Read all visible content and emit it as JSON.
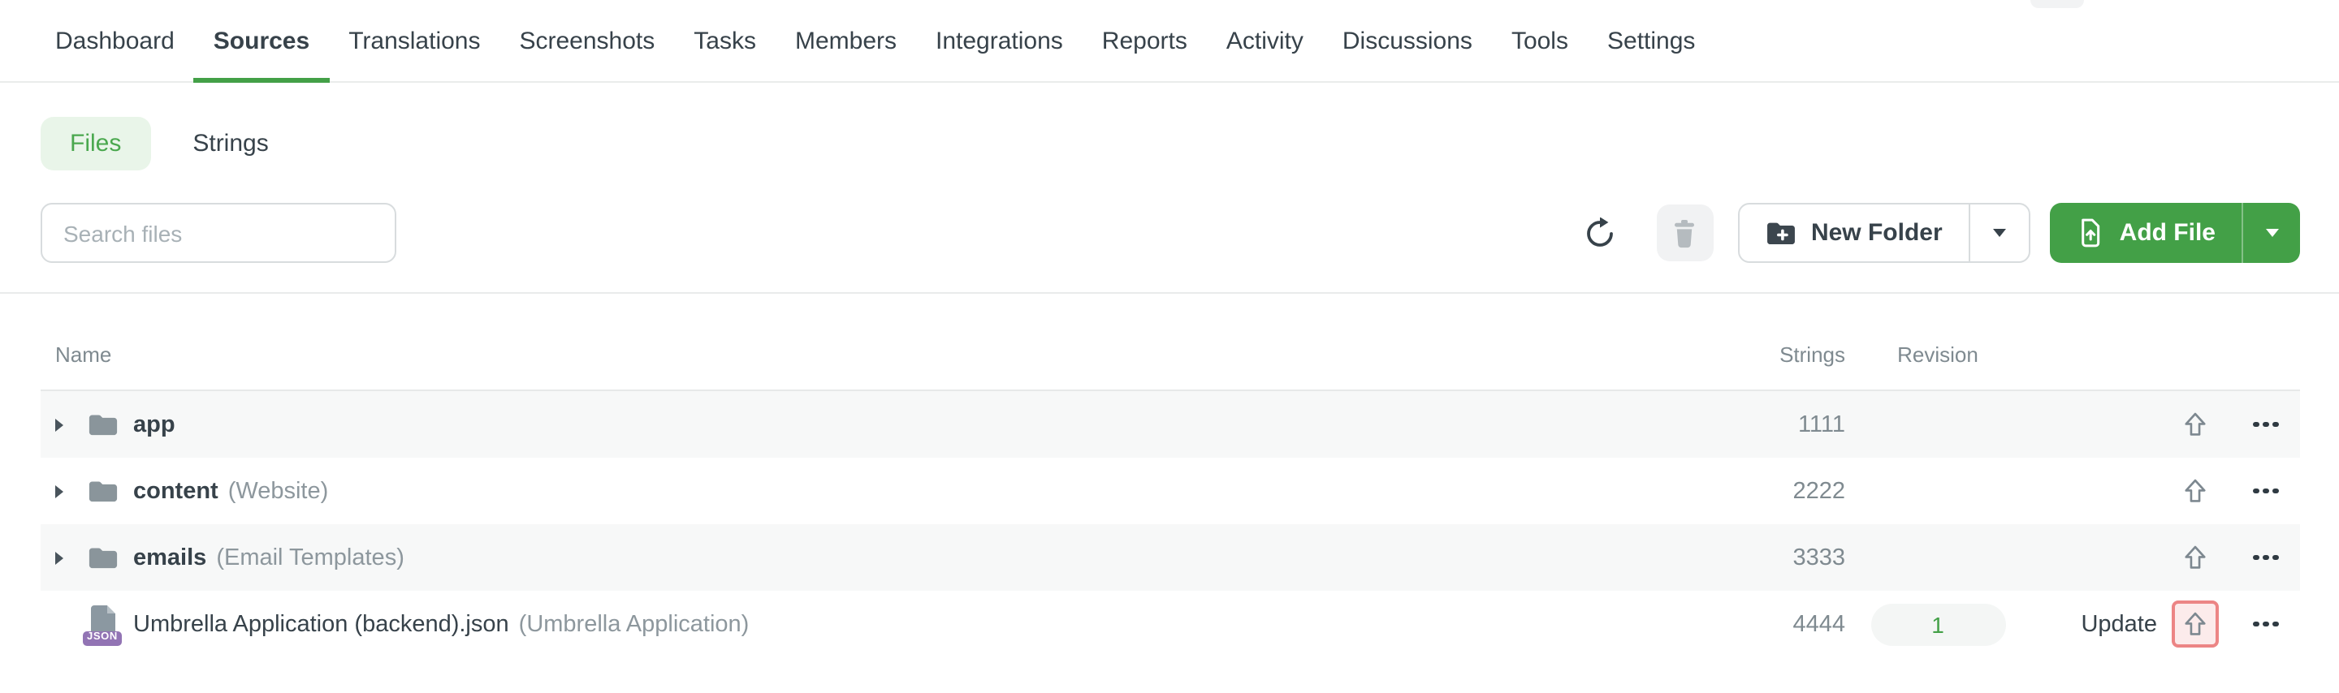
{
  "nav": {
    "items": [
      {
        "label": "Dashboard",
        "active": false
      },
      {
        "label": "Sources",
        "active": true
      },
      {
        "label": "Translations",
        "active": false
      },
      {
        "label": "Screenshots",
        "active": false
      },
      {
        "label": "Tasks",
        "active": false
      },
      {
        "label": "Members",
        "active": false
      },
      {
        "label": "Integrations",
        "active": false
      },
      {
        "label": "Reports",
        "active": false
      },
      {
        "label": "Activity",
        "active": false
      },
      {
        "label": "Discussions",
        "active": false
      },
      {
        "label": "Tools",
        "active": false
      },
      {
        "label": "Settings",
        "active": false
      }
    ]
  },
  "view_tabs": {
    "items": [
      {
        "label": "Files",
        "active": true
      },
      {
        "label": "Strings",
        "active": false
      }
    ]
  },
  "toolbar": {
    "search_placeholder": "Search files",
    "new_folder_label": "New Folder",
    "add_file_label": "Add File"
  },
  "table": {
    "columns": {
      "name": "Name",
      "strings": "Strings",
      "revision": "Revision"
    },
    "rows": [
      {
        "type": "folder",
        "name": "app",
        "note": "",
        "strings": "1111",
        "revision": "",
        "action": ""
      },
      {
        "type": "folder",
        "name": "content",
        "note": "(Website)",
        "strings": "2222",
        "revision": "",
        "action": ""
      },
      {
        "type": "folder",
        "name": "emails",
        "note": "(Email Templates)",
        "strings": "3333",
        "revision": "",
        "action": ""
      },
      {
        "type": "file",
        "name": "Umbrella Application (backend).json",
        "note": "(Umbrella Application)",
        "strings": "4444",
        "revision": "1",
        "action": "Update",
        "badge": "JSON",
        "highlighted": true
      }
    ]
  },
  "colors": {
    "accent_green": "#43a047",
    "files_tab_bg": "#e9f5e9",
    "files_tab_text": "#4aa84e",
    "text_dark": "#37424a",
    "text_gray": "#7f8a90",
    "row_alt_bg": "#f7f8f8",
    "highlight_border": "#ec8585",
    "highlight_bg": "#fcebeb",
    "json_badge_purple": "#9274b4",
    "revision_badge_bg": "#f4f6f5"
  }
}
